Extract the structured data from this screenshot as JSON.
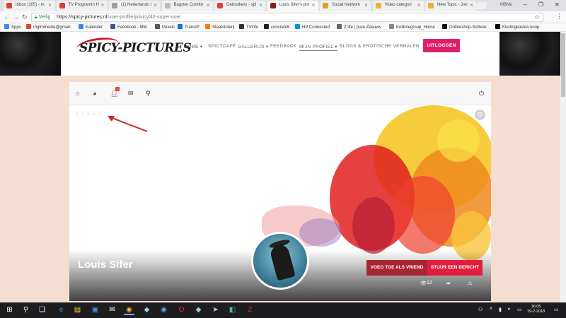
{
  "browser": {
    "tabs": [
      {
        "title": "Inbox (105) - m",
        "fav_color": "#db4437"
      },
      {
        "title": "TV Programm H",
        "fav_color": "#e53935"
      },
      {
        "title": "(1) Nederlands I",
        "fav_color": "#9e9e9e"
      },
      {
        "title": "Bagster Comfor",
        "fav_color": "#bdbdbd"
      },
      {
        "title": "Gebruikers - spi",
        "fav_color": "#e04040"
      },
      {
        "title": "Louis Sifer's pro",
        "fav_color": "#8b1a1a"
      },
      {
        "title": "Social Network",
        "fav_color": "#e0a020"
      },
      {
        "title": "Video categori",
        "fav_color": "#f0b030"
      },
      {
        "title": "New Topic - Jon",
        "fav_color": "#f0b030"
      }
    ],
    "window_label": "MBMo",
    "address": {
      "secure_label": "Veilig",
      "host": "https://spicy-pictures.nl",
      "path": "/user-profile/privicy/42-super-user"
    },
    "bookmarks": [
      {
        "label": "Apps",
        "color": "#4285f4"
      },
      {
        "label": "mgfmmedia@gmail.",
        "color": "#db4437"
      },
      {
        "label": "Kalender",
        "color": "#4285f4"
      },
      {
        "label": "Facebook - MM",
        "color": "#3b5998"
      },
      {
        "label": "Pexels",
        "color": "#555555"
      },
      {
        "label": "TransIP",
        "color": "#1976d2"
      },
      {
        "label": "Staatsloterij",
        "color": "#ff7a00"
      },
      {
        "label": "TVinfo",
        "color": "#333333"
      },
      {
        "label": "concrete5",
        "color": "#222222"
      },
      {
        "label": "HP Connected",
        "color": "#0096d6"
      },
      {
        "label": "Z life | pure Zeeuws",
        "color": "#666666"
      },
      {
        "label": "Kolibriegroup_Home",
        "color": "#888888"
      },
      {
        "label": "Onlineshop-Softwar",
        "color": "#111111"
      },
      {
        "label": "Kledingkasten koop",
        "color": "#000000"
      }
    ]
  },
  "site": {
    "logo": "SPICY-PICTURES",
    "nav": [
      {
        "label": "HOME ▾",
        "current": false
      },
      {
        "label": "SPICYCAFÉ",
        "current": false
      },
      {
        "label": "GALLERIJS ▾",
        "current": false
      },
      {
        "label": "FEEDBACK",
        "current": false
      },
      {
        "label": "MIJN PROFIEL ▾",
        "current": true
      },
      {
        "label": "BLOGS & EROTISCHE VERHALEN",
        "current": false
      }
    ],
    "logout_label": "UITLOGGEN",
    "accent": "#e01f6b"
  },
  "profile": {
    "notification_count": "1",
    "name": "Louis Sifer",
    "add_friend_label": "VOEG TOE ALS VRIEND",
    "send_message_label": "STUUR EEN BERICHT",
    "view_count": "12"
  },
  "taskbar": {
    "time": "16:05",
    "date": "19-2-2018"
  }
}
